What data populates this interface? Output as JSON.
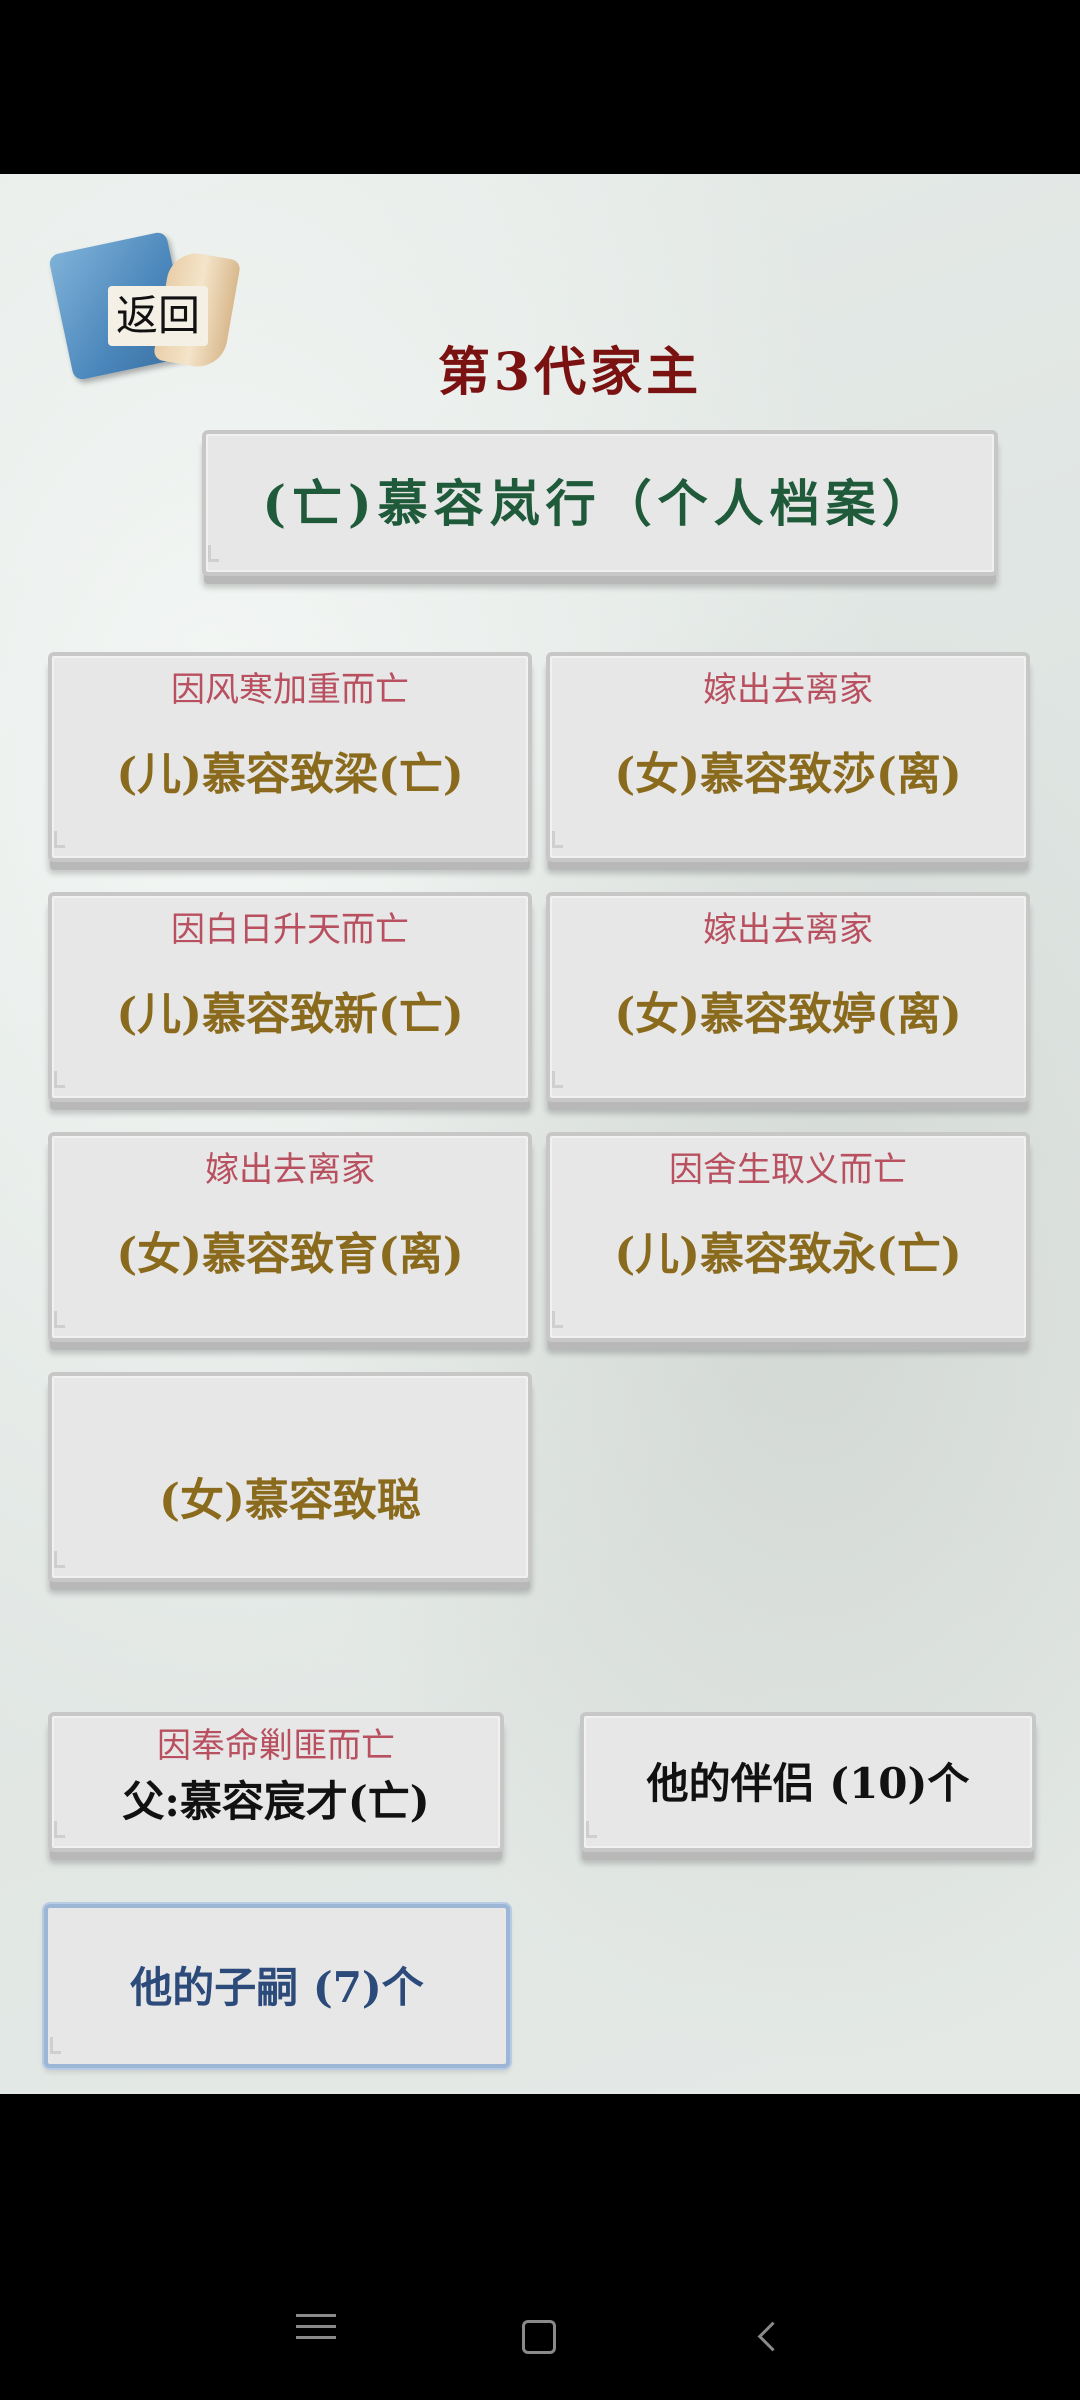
{
  "back_button": {
    "label": "返回"
  },
  "generation_title": "第3代家主",
  "profile_header": "(亡)慕容岚行（个人档案）",
  "children": [
    {
      "fate": "因风寒加重而亡",
      "name": "(儿)慕容致梁(亡)"
    },
    {
      "fate": "嫁出去离家",
      "name": "(女)慕容致莎(离)"
    },
    {
      "fate": "因白日升天而亡",
      "name": "(儿)慕容致新(亡)"
    },
    {
      "fate": "嫁出去离家",
      "name": "(女)慕容致婷(离)"
    },
    {
      "fate": "嫁出去离家",
      "name": "(女)慕容致育(离)"
    },
    {
      "fate": "因舍生取义而亡",
      "name": "(儿)慕容致永(亡)"
    },
    {
      "fate": "",
      "name": "(女)慕容致聪"
    }
  ],
  "father": {
    "fate": "因奉命剿匪而亡",
    "name": "父:慕容宸才(亡)"
  },
  "partners_button": "他的伴侣 (10)个",
  "children_button": "他的子嗣 (7)个",
  "nav": {
    "menu_icon": "menu-icon",
    "home_icon": "home-icon",
    "back_icon": "back-icon"
  }
}
